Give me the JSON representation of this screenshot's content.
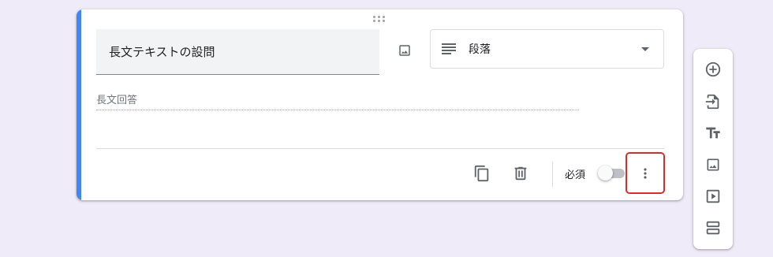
{
  "question": {
    "title": "長文テキストの設問",
    "type_label": "段落",
    "answer_placeholder": "長文回答",
    "required_label": "必須",
    "required": false
  },
  "colors": {
    "accent": "#4285f4",
    "highlight": "#d32f2f",
    "background": "#f0ebf8"
  },
  "icons": {
    "add_image": "image-icon",
    "type": "paragraph-lines-icon",
    "dropdown": "caret-down-icon",
    "duplicate": "copy-icon",
    "delete": "trash-icon",
    "more": "more-vert-icon"
  },
  "toolbar": [
    "add-question-icon",
    "import-questions-icon",
    "title-text-icon",
    "image-icon",
    "video-icon",
    "section-icon"
  ]
}
